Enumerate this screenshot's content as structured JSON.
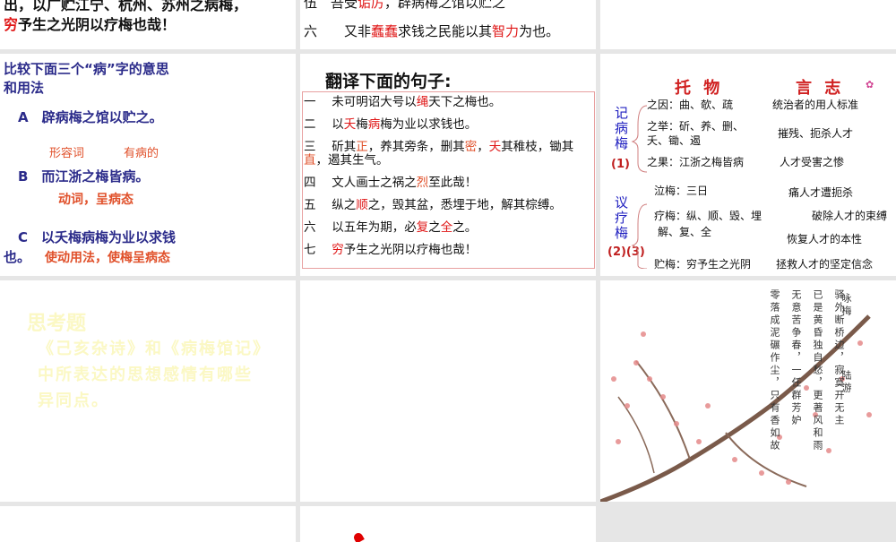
{
  "slide1": {
    "line1": "出，以广贮江宁、杭州、苏州之病梅，",
    "line2": [
      {
        "t": "穷",
        "hl": "r"
      },
      {
        "t": "予生之光阴以疗梅也哉！"
      }
    ]
  },
  "slide2": {
    "line1": [
      {
        "t": "伍　吾受"
      },
      {
        "t": "诟厉",
        "hl": "r"
      },
      {
        "t": "，辟病梅之馆以贮之"
      }
    ],
    "line2": [
      {
        "t": "六　　又非"
      },
      {
        "t": "蠢蠢",
        "hl": "r"
      },
      {
        "t": "求钱之民能以其"
      },
      {
        "t": "智力",
        "hl": "r"
      },
      {
        "t": "为也。"
      }
    ]
  },
  "slide4": {
    "title1": "比较下面三个“病”字的意思",
    "title2": "和用法",
    "a": "A　辟病梅之馆以贮之。",
    "a_note1": "形容词",
    "a_note2": "有病的",
    "b": "B　而江浙之梅皆病。",
    "b_note": "动词，呈病态",
    "c": "C　以夭梅病梅为业以求钱",
    "c2": "也。",
    "c_note": "使动用法，使梅呈病态"
  },
  "slide5": {
    "title": "翻译下面的句子:",
    "sentences": [
      [
        {
          "t": "一　 未可明诏大号以"
        },
        {
          "t": "绳",
          "hl": "r"
        },
        {
          "t": "天下之梅也。"
        }
      ],
      [
        {
          "t": "二　 以"
        },
        {
          "t": "夭",
          "hl": "r"
        },
        {
          "t": "梅"
        },
        {
          "t": "病",
          "hl": "r"
        },
        {
          "t": "梅为业以求钱也。"
        }
      ],
      [
        {
          "t": "三　 斫其"
        },
        {
          "t": "正",
          "hl": "o"
        },
        {
          "t": "，养其旁条，删其"
        },
        {
          "t": "密",
          "hl": "o"
        },
        {
          "t": "，"
        },
        {
          "t": "夭",
          "hl": "r"
        },
        {
          "t": "其稚枝，锄其"
        },
        {
          "t": "直",
          "hl": "o"
        },
        {
          "t": "，遏其生气。"
        }
      ],
      [
        {
          "t": "四　 文人画士之祸之"
        },
        {
          "t": "烈",
          "hl": "o"
        },
        {
          "t": "至此哉！"
        }
      ],
      [
        {
          "t": "五　 纵之"
        },
        {
          "t": "顺",
          "hl": "r"
        },
        {
          "t": "之，毁其盆，悉埋于地，解其棕缚。"
        }
      ],
      [
        {
          "t": "六　 以五年为期，必"
        },
        {
          "t": "复",
          "hl": "r"
        },
        {
          "t": "之"
        },
        {
          "t": "全",
          "hl": "r"
        },
        {
          "t": "之。"
        }
      ],
      [
        {
          "t": "七　 "
        },
        {
          "t": "穷",
          "hl": "r"
        },
        {
          "t": "予生之光阴以疗梅也哉！"
        }
      ]
    ]
  },
  "slide6": {
    "head_left": "托 物",
    "head_right": "言 志",
    "group1_label": "记病梅",
    "group1_num": "(1)",
    "group2_label": "议疗梅",
    "group2_num": "(2)(3)",
    "rows": [
      {
        "left": "之因：曲、欹、疏",
        "right": "统治者的用人标准"
      },
      {
        "left": "之举：斫、养、删、",
        "left2": "夭、锄、遏",
        "right": "摧残、扼杀人才"
      },
      {
        "left": "之果：江浙之梅皆病",
        "right": "人才受害之惨"
      },
      {
        "left": "泣梅：三日",
        "right": "痛人才遭扼杀"
      },
      {
        "left": "疗梅：纵、顺、毁、埋",
        "left2": "解、复、全",
        "right": "破除人才的束缚",
        "right2": "恢复人才的本性"
      },
      {
        "left": "贮梅：穷予生之光阴",
        "right": "拯救人才的坚定信念"
      }
    ]
  },
  "slide7": {
    "title": "思考题",
    "body": "《己亥杂诗》和《病梅馆记》中所表达的思想感情有哪些异同点。"
  },
  "slide9": {
    "poem_title": "咏梅",
    "author": "陆游",
    "columns": [
      "驿外断桥边，寂寞开无主",
      "已是黄昏独自愁，更著风和雨",
      "无意苦争春，一任群芳妒",
      "零落成泥碾作尘，只有香如故"
    ]
  }
}
